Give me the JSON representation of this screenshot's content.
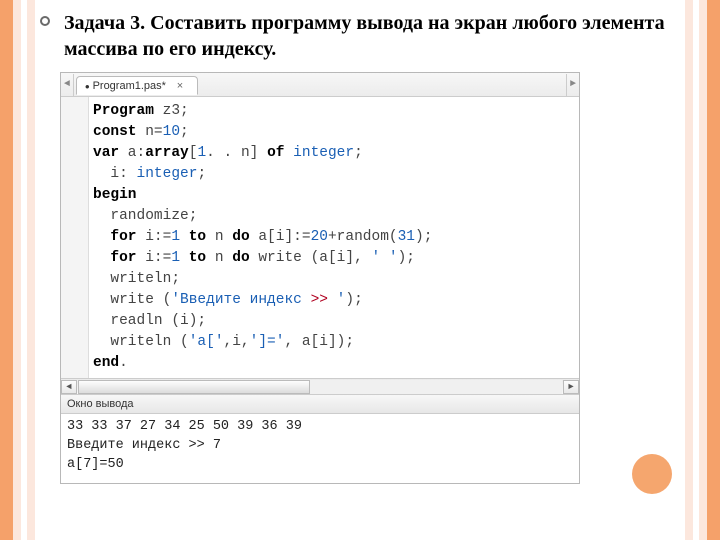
{
  "heading": {
    "prefix": "Задача 3.",
    "rest": " Составить программу вывода на экран любого элемента массива по его индексу."
  },
  "tabs": {
    "active": "Program1.pas*"
  },
  "code": {
    "l1_kw": "Program",
    "l1_rest": " z3;",
    "l2_kw": "const",
    "l2_rest": " n=",
    "l2_num": "10",
    "l2_end": ";",
    "l3_kw": "var",
    "l3_a": " a:",
    "l3_kw2": "array",
    "l3_br": "[",
    "l3_r1": "1",
    "l3_dots": ". .",
    "l3_r2": " n] ",
    "l3_kw3": "of",
    "l3_sp": " ",
    "l3_ty": "integer",
    "l3_end": ";",
    "l4_pre": "  i: ",
    "l4_ty": "integer",
    "l4_end": ";",
    "l5_kw": "begin",
    "l6": "  randomize;",
    "l7_pre": "  ",
    "l7_kw1": "for",
    "l7_a": " i:=",
    "l7_n1": "1",
    "l7_sp1": " ",
    "l7_kw2": "to",
    "l7_b": " n ",
    "l7_kw3": "do",
    "l7_c": " a[i]:=",
    "l7_n2": "20",
    "l7_plus": "+random(",
    "l7_n3": "31",
    "l7_end": ");",
    "l8_pre": "  ",
    "l8_kw1": "for",
    "l8_a": " i:=",
    "l8_n1": "1",
    "l8_sp1": " ",
    "l8_kw2": "to",
    "l8_b": " n ",
    "l8_kw3": "do",
    "l8_c": " write (a[i], ",
    "l8_str": "' '",
    "l8_end": ");",
    "l9": "  writeln;",
    "l10_pre": "  write (",
    "l10_str": "'Введите индекс ",
    "l10_op": ">>",
    "l10_str2": " '",
    "l10_end": ");",
    "l11": "  readln (i);",
    "l12_pre": "  writeln (",
    "l12_s1": "'a['",
    "l12_c1": ",i,",
    "l12_s2": "']='",
    "l12_c2": ", a[i]);",
    "l13_kw": "end",
    "l13_dot": "."
  },
  "output": {
    "panel_label": "Окно вывода",
    "line1": "33 33 37 27 34 25 50 39 36 39",
    "line2": "Введите индекс >> 7",
    "line3": "a[7]=50"
  }
}
